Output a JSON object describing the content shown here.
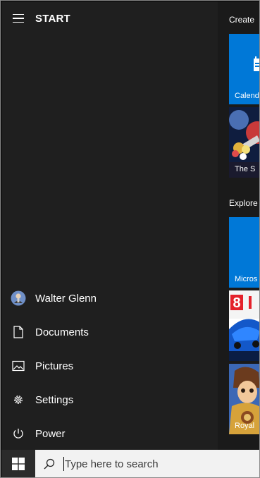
{
  "header": {
    "title": "START",
    "menu_icon": "hamburger-icon"
  },
  "menu": [
    {
      "label": "Walter Glenn",
      "icon": "user-avatar"
    },
    {
      "label": "Documents",
      "icon": "document-icon"
    },
    {
      "label": "Pictures",
      "icon": "pictures-icon"
    },
    {
      "label": "Settings",
      "icon": "gear-icon"
    },
    {
      "label": "Power",
      "icon": "power-icon"
    }
  ],
  "tiles": {
    "create": {
      "label": "Create",
      "items": [
        {
          "label": "Calend",
          "icon": "calendar-icon",
          "color": "#0078d7"
        },
        {
          "label": "The S",
          "icon": "game-art",
          "color": "#1b2a4a"
        }
      ]
    },
    "explore": {
      "label": "Explore",
      "items": [
        {
          "label": "Micros",
          "icon": "store-icon",
          "color": "#0078d7"
        },
        {
          "label": "",
          "icon": "racing-game-art",
          "color": "#0d3a8a"
        },
        {
          "label": "Royal",
          "icon": "game-art",
          "color": "#2a4d86"
        }
      ]
    }
  },
  "taskbar": {
    "start_icon": "windows-logo-icon",
    "search_icon": "search-icon",
    "search_placeholder": "Type here to search"
  },
  "colors": {
    "panel": "#1f1f1f",
    "tile_blue": "#0078d7",
    "taskbar": "#101010",
    "search_bg": "#f2f2f2"
  }
}
